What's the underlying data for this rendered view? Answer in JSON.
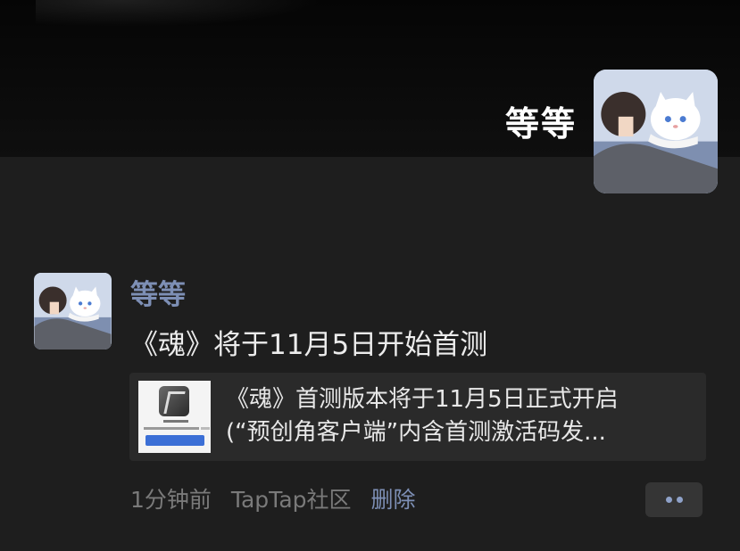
{
  "cover": {
    "user_name": "等等"
  },
  "post": {
    "author": "等等",
    "text": "《魂》将于11月5日开始首测",
    "link": {
      "title_line1": "《魂》首测版本将于11月5日正式开启",
      "title_line2": "(“预创角客户端”内含首测激活码发..."
    },
    "meta": {
      "time": "1分钟前",
      "source": "TapTap社区",
      "delete_label": "删除"
    }
  },
  "icons": {
    "more": "more-dots-icon"
  }
}
